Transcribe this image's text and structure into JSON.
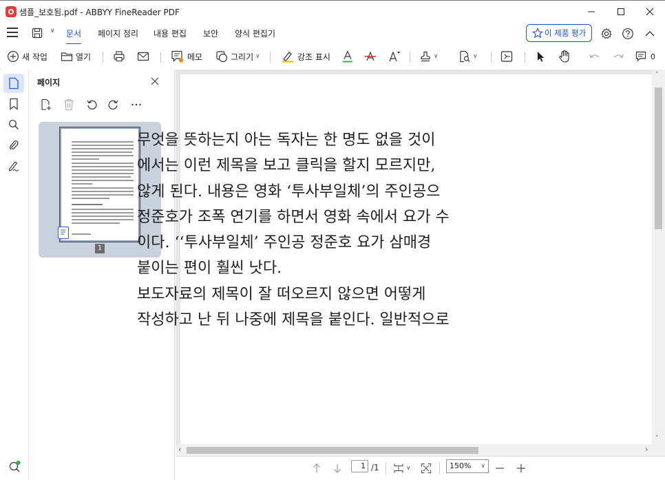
{
  "window": {
    "title": "샘플_보호됨.pdf - ABBYY FineReader PDF"
  },
  "menu": {
    "tabs": [
      {
        "label": "문서",
        "active": true
      },
      {
        "label": "페이지 정리",
        "active": false
      },
      {
        "label": "내용 편집",
        "active": false
      },
      {
        "label": "보안",
        "active": false
      },
      {
        "label": "양식 편집기",
        "active": false
      }
    ],
    "rate_button": "이 제품 평가"
  },
  "toolbar": {
    "new_task": "새 작업",
    "open": "열기",
    "memo": "메모",
    "draw": "그리기",
    "highlight": "강조 표시",
    "comment_count": "0"
  },
  "panel": {
    "title": "페이지",
    "thumbnail_page_number": "1"
  },
  "document": {
    "lines": [
      "무엇을 뜻하는지 아는 독자는 한 명도 없을 것이",
      "에서는 이런 제목을 보고 클릭을 할지 모르지만,",
      "않게 된다. 내용은 영화 ‘투사부일체’의 주인공으",
      "정준호가 조폭 연기를 하면서 영화 속에서 요가 수",
      "이다. ‘‘투사부일체’ 주인공 정준호 요가 삼매경",
      "붙이는 편이 훨씬 낫다.",
      "  보도자료의 제목이 잘 떠오르지 않으면 어떻게",
      "작성하고 난 뒤 나중에 제목을 붙인다. 일반적으로"
    ]
  },
  "statusbar": {
    "current_page": "1",
    "total_pages": "/1",
    "zoom": "150%"
  },
  "colors": {
    "accent": "#1d4fd8",
    "active_bg": "#dbe6fb",
    "logo_red": "#e83a3a",
    "highlight_underline": "#3cb043",
    "strike_red": "#e03030"
  }
}
